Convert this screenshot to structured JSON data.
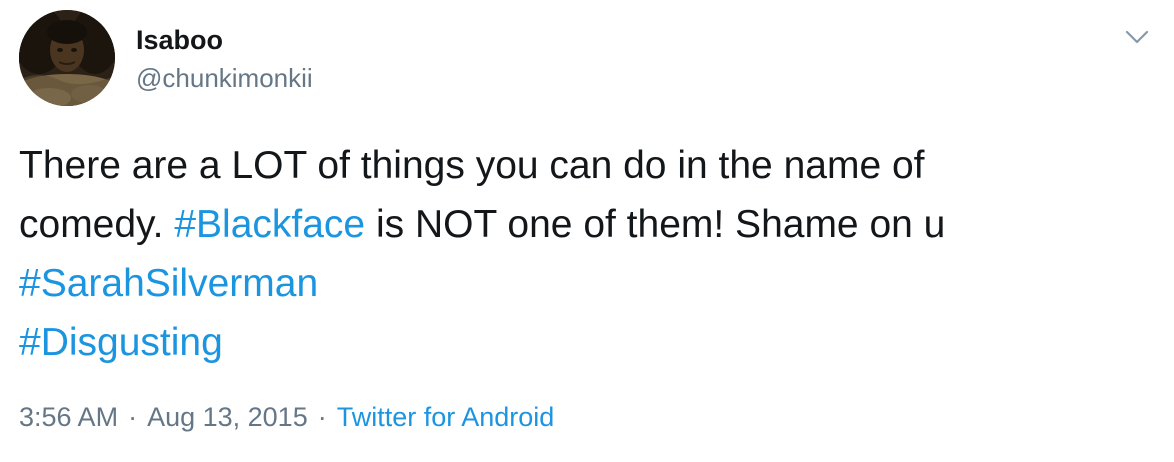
{
  "user": {
    "name": "Isaboo",
    "handle": "@chunkimonkii"
  },
  "tweet": {
    "line1": "There are a LOT of things you can do in the name of",
    "line2_prefix": "comedy. ",
    "hashtag_blackface": "#Blackface",
    "line2_suffix": " is NOT one of them! Shame on u",
    "hashtag_sarahsilverman": "#SarahSilverman",
    "hashtag_disgusting": "#Disgusting"
  },
  "meta": {
    "time": "3:56 AM",
    "separator": "·",
    "date": "Aug 13, 2015",
    "source": "Twitter for Android"
  },
  "colors": {
    "text": "#14171a",
    "secondary": "#657786",
    "link": "#1b95e0"
  },
  "icons": {
    "menu": "chevron-down-icon"
  }
}
